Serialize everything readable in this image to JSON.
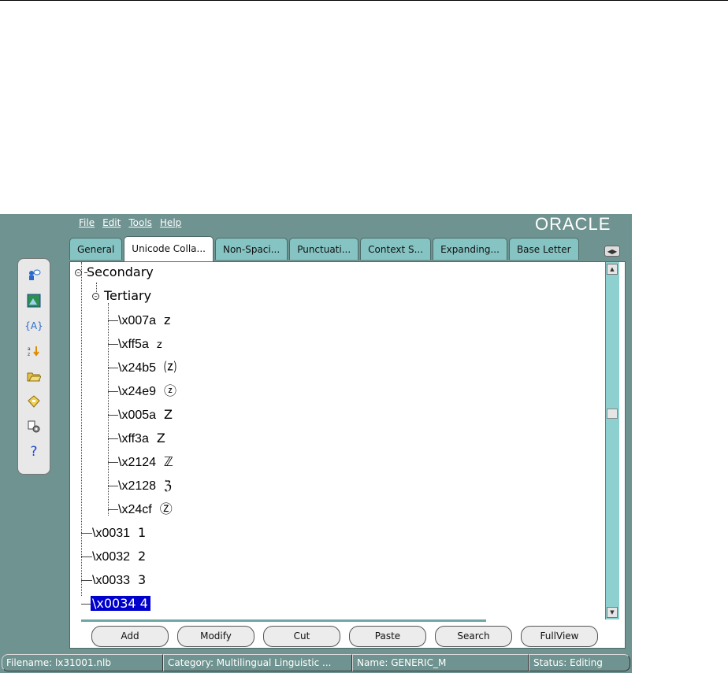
{
  "menu": {
    "file": "File",
    "edit": "Edit",
    "tools": "Tools",
    "help": "Help"
  },
  "logo": "ORACLE",
  "tabs": [
    {
      "label": "General"
    },
    {
      "label": "Unicode Colla..."
    },
    {
      "label": "Non-Spaci..."
    },
    {
      "label": "Punctuati..."
    },
    {
      "label": "Context S..."
    },
    {
      "label": "Expanding..."
    },
    {
      "label": "Base Letter"
    }
  ],
  "toolbar_icons": [
    "user-help-icon",
    "image-icon",
    "variable-icon",
    "sort-icon",
    "open-folder-icon",
    "save-icon",
    "settings-icon",
    "help-icon"
  ],
  "tree": {
    "secondary": "Secondary",
    "tertiary": "Tertiary",
    "tertiary_items": [
      {
        "code": "\\x007a",
        "char": "z"
      },
      {
        "code": "\\xff5a",
        "char": "z"
      },
      {
        "code": "\\x24b5",
        "char": "⒵"
      },
      {
        "code": "\\x24e9",
        "char": "ⓩ"
      },
      {
        "code": "\\x005a",
        "char": "Z"
      },
      {
        "code": "\\xff3a",
        "char": "Z"
      },
      {
        "code": "\\x2124",
        "char": "ℤ"
      },
      {
        "code": "\\x2128",
        "char": "ℨ"
      },
      {
        "code": "\\x24cf",
        "char": "Ⓩ"
      }
    ],
    "root_items": [
      {
        "code": "\\x0031",
        "char": "1"
      },
      {
        "code": "\\x0032",
        "char": "2"
      },
      {
        "code": "\\x0033",
        "char": "3"
      },
      {
        "code": "\\x0034",
        "char": "4"
      }
    ],
    "selected": "\\x0034  4"
  },
  "buttons": {
    "add": "Add",
    "modify": "Modify",
    "cut": "Cut",
    "paste": "Paste",
    "search": "Search",
    "fullview": "FullView"
  },
  "status": {
    "filename": "Filename: lx31001.nlb",
    "category": "Category: Multilingual Linguistic ...",
    "name": "Name: GENERIC_M",
    "state": "Status: Editing"
  },
  "colors": {
    "app_background": "#6f9390",
    "tab_background": "#86c4c4",
    "selection": "#0000cc"
  }
}
